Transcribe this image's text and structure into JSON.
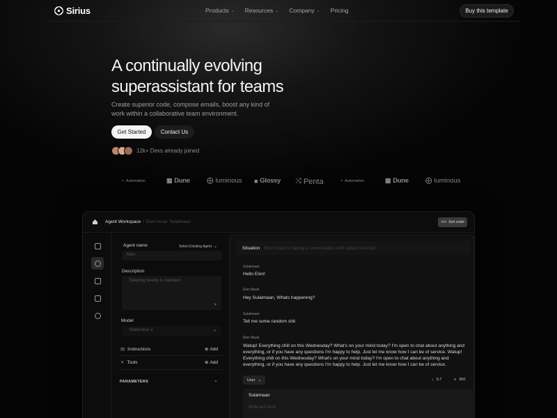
{
  "nav": {
    "brand": "Sirius",
    "menu": [
      {
        "label": "Products",
        "has_dropdown": true
      },
      {
        "label": "Resources",
        "has_dropdown": true
      },
      {
        "label": "Company",
        "has_dropdown": true
      },
      {
        "label": "Pricing",
        "has_dropdown": false
      }
    ],
    "cta": "Buy this template"
  },
  "hero": {
    "title_line1": "A continually evolving",
    "title_line2": "superassistant for teams",
    "subtitle": "Create superior code, compose emails, boost any kind of work within a collaborative team environment.",
    "primary_button": "Get Started",
    "secondary_button": "Contact Us",
    "social_proof": "12k+ Devs already joined"
  },
  "logos": [
    "Automation",
    "Dune",
    "luminous",
    "Glossy",
    "Penta",
    "Automation",
    "Dune",
    "luminous"
  ],
  "app": {
    "breadcrumb": {
      "root": "Agent Workspace",
      "sep": "/",
      "path1": "Elon musk",
      "path2": "Sulaimaan"
    },
    "get_code": "Get code",
    "config": {
      "agent_name_label": "Agent name",
      "select_existing": "Select Existing Agent",
      "agent_name_value": "Allen",
      "description_label": "Description",
      "description_placeholder": "Sleeping beauty is standard",
      "model_label": "Model",
      "model_value": "Siddardhar-1",
      "instructions_label": "Instructions",
      "tools_label": "Tools",
      "add_label": "Add",
      "parameters_label": "PARAMETERS"
    },
    "chat": {
      "situation_label": "Situation",
      "situation_placeholder": "Elon musk is having a conversation with space scientist",
      "messages": [
        {
          "name": "Sulaimaan",
          "text": "Hello Elon!"
        },
        {
          "name": "Elon Musk",
          "text": "Hey Sulaimaan, Whats happening?"
        },
        {
          "name": "Sulaimaan",
          "text": "Tell me some random shit"
        },
        {
          "name": "Elon Musk",
          "text": "Watup!  Everything chill on this Wednesday? What's on your mind today? I'm open to chat about anything and everything, or if you have any questions I'm happy to help. Just let me know how I can be of service. Watup! Everything chill on this Wednesday? What's on your mind today? I'm open to chat about anything and everything, or if you have any questions I'm happy to help. Just let me know how I can be of service."
        }
      ],
      "role_select": "User",
      "temperature": "0.7",
      "max_tokens": "300",
      "compose_name": "Sulaimaan",
      "compose_placeholder": "Write text here"
    }
  },
  "colors": {
    "background": "#050505",
    "accent": "#f4f4f4",
    "panel": "#111111"
  }
}
